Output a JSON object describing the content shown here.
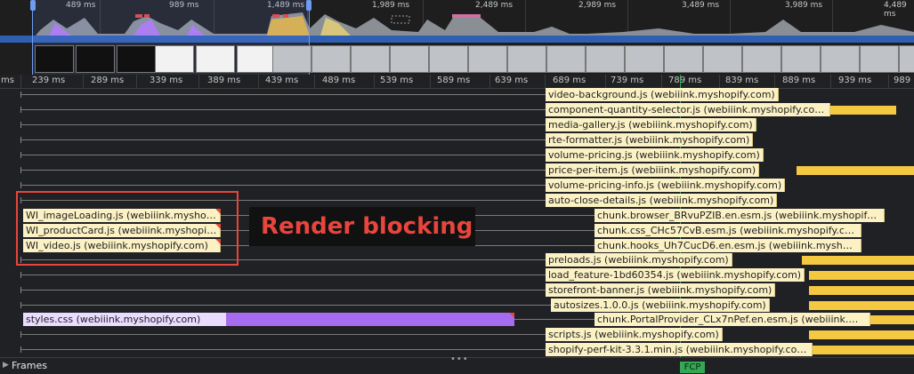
{
  "overview": {
    "labels": [
      "489 ms",
      "989 ms",
      "1,489 ms",
      "1,989 ms",
      "2,489 ms",
      "2,989 ms",
      "3,489 ms",
      "3,989 ms",
      "4,489 ms"
    ]
  },
  "ruler": {
    "ticks": [
      "ms",
      "239 ms",
      "289 ms",
      "339 ms",
      "389 ms",
      "439 ms",
      "489 ms",
      "539 ms",
      "589 ms",
      "639 ms",
      "689 ms",
      "739 ms",
      "789 ms",
      "839 ms",
      "889 ms",
      "939 ms",
      "989 ms"
    ]
  },
  "requests": [
    {
      "label": "video-background.js (webiiink.myshopify.com)"
    },
    {
      "label": "component-quantity-selector.js (webiiink.myshopify.com)"
    },
    {
      "label": "media-gallery.js (webiiink.myshopify.com)"
    },
    {
      "label": "rte-formatter.js (webiiink.myshopify.com)"
    },
    {
      "label": "volume-pricing.js (webiiink.myshopify.com)"
    },
    {
      "label": "price-per-item.js (webiiink.myshopify.com)"
    },
    {
      "label": "volume-pricing-info.js (webiiink.myshopify.com)"
    },
    {
      "label": "auto-close-details.js (webiiink.myshopify.com)"
    },
    {
      "label": "WI_imageLoading.js (webiiink.myshop…"
    },
    {
      "label": "WI_productCard.js (webiiink.myshopif…"
    },
    {
      "label": "WI_video.js (webiiink.myshopify.com)"
    },
    {
      "label": "chunk.browser_BRvuPZIB.en.esm.js (webiiink.myshopify.c…"
    },
    {
      "label": "chunk.css_CHc57CvB.esm.js (webiiink.myshopify.com)"
    },
    {
      "label": "chunk.hooks_Uh7CucD6.en.esm.js (webiiink.myshopify.com)"
    },
    {
      "label": "preloads.js (webiiink.myshopify.com)"
    },
    {
      "label": "load_feature-1bd60354.js (webiiink.myshopify.com)"
    },
    {
      "label": "storefront-banner.js (webiiink.myshopify.com)"
    },
    {
      "label": "autosizes.1.0.0.js (webiiink.myshopify.com)"
    },
    {
      "label": "styles.css (webiiink.myshopify.com)"
    },
    {
      "label": "chunk.PortalProvider_CLx7nPef.en.esm.js (webiiink.mysh…"
    },
    {
      "label": "scripts.js (webiiink.myshopify.com)"
    },
    {
      "label": "shopify-perf-kit-3.3.1.min.js (webiiink.myshopify.com)"
    }
  ],
  "annotation": {
    "text": "Render blocking"
  },
  "frames": {
    "label": "Frames"
  },
  "marker": {
    "label": "FCP"
  },
  "colors": {
    "script_wait": "#fbf1c4",
    "script_download": "#f5c842",
    "style_download": "#a66bf0",
    "style_wait": "#eadcff",
    "annotation": "#e8453c",
    "fcp": "#34a853"
  }
}
